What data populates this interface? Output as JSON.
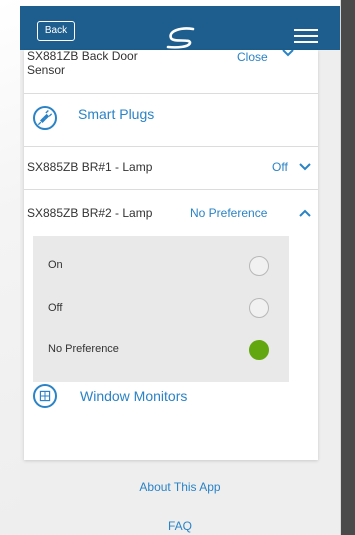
{
  "header": {
    "back_label": "Back",
    "logo_icon": "brand-s-logo",
    "menu_icon": "hamburger-menu-icon",
    "bar_color": "#1d5e8e"
  },
  "devices": {
    "partial_row": {
      "name_line1": "SX881ZB Back Door",
      "name_line2": "Sensor",
      "status": "Close"
    },
    "smart_plugs": {
      "title": "Smart Plugs",
      "icon": "plug-icon",
      "items": [
        {
          "name": "SX885ZB BR#1 - Lamp",
          "status": "Off",
          "expanded": false
        },
        {
          "name": "SX885ZB BR#2 - Lamp",
          "status": "No Preference",
          "expanded": true
        }
      ],
      "options": [
        {
          "label": "On",
          "selected": false
        },
        {
          "label": "Off",
          "selected": false
        },
        {
          "label": "No Preference",
          "selected": true
        }
      ]
    },
    "window_monitors": {
      "title": "Window Monitors",
      "icon": "window-icon"
    }
  },
  "footer": {
    "about_label": "About This App",
    "faq_label": "FAQ"
  },
  "colors": {
    "accent": "#2a83c6",
    "selected": "#62a70f"
  }
}
